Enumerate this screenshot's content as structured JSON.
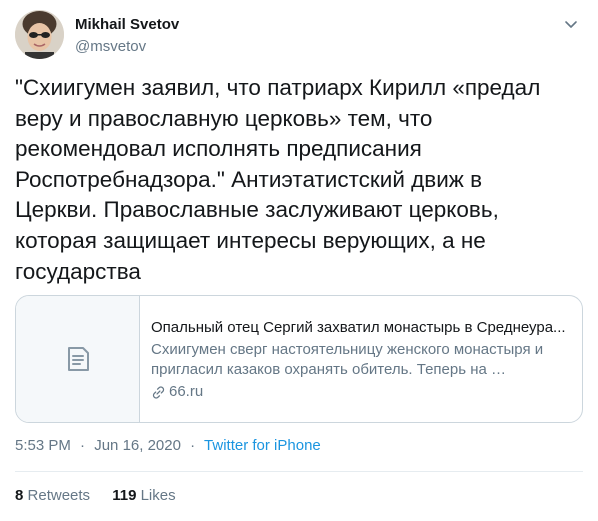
{
  "author": {
    "display_name": "Mikhail Svetov",
    "handle": "@msvetov"
  },
  "tweet": {
    "text": "\"Схиигумен заявил, что патриарх Кирилл «предал\nверу и православную церковь» тем, что\nрекомендовал исполнять предписания\nРоспотребнадзора.\" Антиэтатистский движ в\nЦеркви. Православные заслуживают церковь,\nкоторая защищает интересы верующих, а не\nгосударства"
  },
  "card": {
    "title": "Опальный отец Сергий захватил монастырь в Среднеура...",
    "description": "Схиигумен сверг настоятельницу женского монастыря и пригласил казаков охранять обитель. Теперь на …",
    "domain": "66.ru",
    "thumb_icon": "document-icon",
    "link_icon": "link-icon"
  },
  "meta": {
    "time": "5:53 PM",
    "separator": "·",
    "date": "Jun 16, 2020",
    "source": "Twitter for iPhone"
  },
  "stats": {
    "retweets_count": "8",
    "retweets_label": "Retweets",
    "likes_count": "119",
    "likes_label": "Likes"
  },
  "colors": {
    "text": "#14171a",
    "secondary": "#657786",
    "accent": "#1b95e0",
    "border": "#ccd6dd"
  }
}
